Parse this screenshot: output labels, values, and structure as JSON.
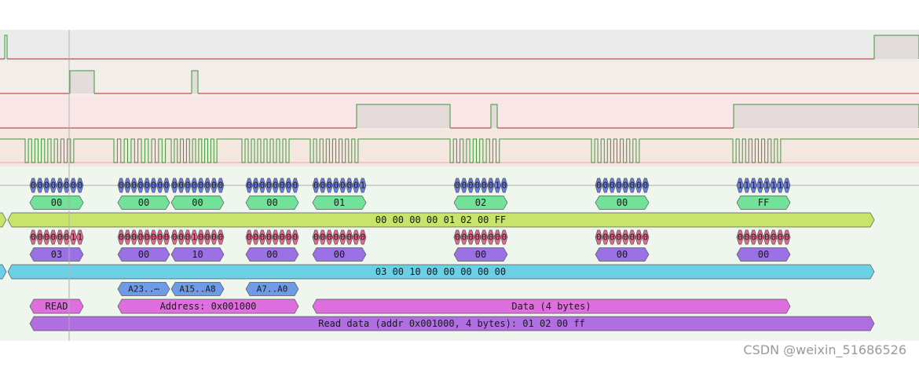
{
  "watermark": "CSDN @weixin_51686526",
  "colors": {
    "row_bg": [
      "#ebebeb",
      "#f3eee9",
      "#f9e7e7",
      "#f3e7e0"
    ],
    "decode_bg": "#eef6ee",
    "signal_line": "#b42828",
    "signal_high": "#3a9a3a",
    "bits_blue": "#6b7fe0",
    "bits_red": "#e56a8c",
    "byte_green": "#72e29a",
    "byte_purple": "#9a72e6",
    "transfer_lime": "#c9e46a",
    "transfer_cyan": "#6bcfe6",
    "addr_blue": "#6f9be6",
    "command_pink": "#df6fdf",
    "read_violet": "#b06fe0"
  },
  "mosi_bits": [
    {
      "bits": [
        "0",
        "0",
        "0",
        "0",
        "0",
        "0",
        "0",
        "0"
      ]
    },
    {
      "bits": [
        "0",
        "0",
        "0",
        "0",
        "0",
        "0",
        "0",
        "0"
      ]
    },
    {
      "bits": [
        "0",
        "0",
        "0",
        "0",
        "0",
        "0",
        "0",
        "0"
      ]
    },
    {
      "bits": [
        "0",
        "0",
        "0",
        "0",
        "0",
        "0",
        "0",
        "0"
      ]
    },
    {
      "bits": [
        "0",
        "0",
        "0",
        "0",
        "0",
        "0",
        "0",
        "1"
      ]
    },
    {
      "bits": [
        "0",
        "0",
        "0",
        "0",
        "0",
        "0",
        "1",
        "0"
      ]
    },
    {
      "bits": [
        "0",
        "0",
        "0",
        "0",
        "0",
        "0",
        "0",
        "0"
      ]
    },
    {
      "bits": [
        "1",
        "1",
        "1",
        "1",
        "1",
        "1",
        "1",
        "1"
      ]
    }
  ],
  "mosi_bytes": [
    "00",
    "00",
    "00",
    "00",
    "01",
    "02",
    "00",
    "FF"
  ],
  "mosi_transfer": "00 00 00 00 01 02 00 FF",
  "miso_bits": [
    {
      "bits": [
        "0",
        "0",
        "0",
        "0",
        "0",
        "0",
        "1",
        "1"
      ]
    },
    {
      "bits": [
        "0",
        "0",
        "0",
        "0",
        "0",
        "0",
        "0",
        "0"
      ]
    },
    {
      "bits": [
        "0",
        "0",
        "0",
        "1",
        "0",
        "0",
        "0",
        "0"
      ]
    },
    {
      "bits": [
        "0",
        "0",
        "0",
        "0",
        "0",
        "0",
        "0",
        "0"
      ]
    },
    {
      "bits": [
        "0",
        "0",
        "0",
        "0",
        "0",
        "0",
        "0",
        "0"
      ]
    },
    {
      "bits": [
        "0",
        "0",
        "0",
        "0",
        "0",
        "0",
        "0",
        "0"
      ]
    },
    {
      "bits": [
        "0",
        "0",
        "0",
        "0",
        "0",
        "0",
        "0",
        "0"
      ]
    },
    {
      "bits": [
        "0",
        "0",
        "0",
        "0",
        "0",
        "0",
        "0",
        "0"
      ]
    }
  ],
  "miso_bytes": [
    "03",
    "00",
    "10",
    "00",
    "00",
    "00",
    "00",
    "00"
  ],
  "miso_transfer": "03 00 10 00 00 00 00 00",
  "address_fields": [
    "A23..⋯",
    "A15..A8",
    "A7..A0"
  ],
  "command_label": "READ",
  "address_label": "Address: 0x001000",
  "data_label": "Data (4 bytes)",
  "read_label": "Read data (addr 0x001000, 4 bytes): 01 02 00 ff"
}
